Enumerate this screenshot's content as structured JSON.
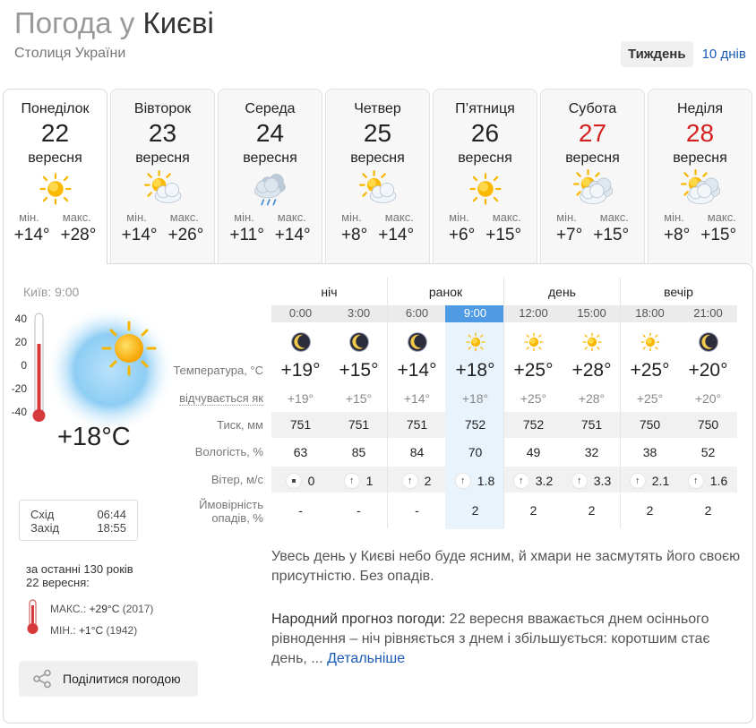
{
  "header": {
    "title_prefix": "Погода у",
    "city": "Києві",
    "subtitle": "Столиця України"
  },
  "period": {
    "week": "Тиждень",
    "ten_days": "10 днів"
  },
  "days": [
    {
      "name": "Понеділок",
      "num": "22",
      "month": "вересня",
      "icon": "sun-icon",
      "min_label": "мін.",
      "max_label": "макс.",
      "min": "+14°",
      "max": "+28°",
      "weekend": false
    },
    {
      "name": "Вівторок",
      "num": "23",
      "month": "вересня",
      "icon": "sun-cloud-icon",
      "min_label": "мін.",
      "max_label": "макс.",
      "min": "+14°",
      "max": "+26°",
      "weekend": false
    },
    {
      "name": "Середа",
      "num": "24",
      "month": "вересня",
      "icon": "rain-cloud-icon",
      "min_label": "мін.",
      "max_label": "макс.",
      "min": "+11°",
      "max": "+14°",
      "weekend": false
    },
    {
      "name": "Четвер",
      "num": "25",
      "month": "вересня",
      "icon": "sun-cloud-icon",
      "min_label": "мін.",
      "max_label": "макс.",
      "min": "+8°",
      "max": "+14°",
      "weekend": false
    },
    {
      "name": "П’ятниця",
      "num": "26",
      "month": "вересня",
      "icon": "sun-icon",
      "min_label": "мін.",
      "max_label": "макс.",
      "min": "+6°",
      "max": "+15°",
      "weekend": false
    },
    {
      "name": "Субота",
      "num": "27",
      "month": "вересня",
      "icon": "sun-clouds-icon",
      "min_label": "мін.",
      "max_label": "макс.",
      "min": "+7°",
      "max": "+15°",
      "weekend": true
    },
    {
      "name": "Неділя",
      "num": "28",
      "month": "вересня",
      "icon": "sun-clouds-icon",
      "min_label": "мін.",
      "max_label": "макс.",
      "min": "+8°",
      "max": "+15°",
      "weekend": true
    }
  ],
  "current": {
    "location_time": "Київ: 9:00",
    "temp": "+18°C",
    "thermo_ticks": [
      "40",
      "20",
      "0",
      "-20",
      "-40"
    ],
    "sunrise_label": "Схід",
    "sunrise": "06:44",
    "sunset_label": "Захід",
    "sunset": "18:55"
  },
  "history": {
    "line1": "за останні 130 років",
    "line2": "22 вересня:",
    "max_label": "МАКС.:",
    "max_val": "+29°C",
    "max_year": "(2017)",
    "min_label": "МІН.:",
    "min_val": "+1°C",
    "min_year": "(1942)"
  },
  "share_label": "Поділитися погодою",
  "row_labels": {
    "temp": "Температура, °C",
    "feels": "відчувається як",
    "pressure": "Тиск, мм",
    "humidity": "Вологість, %",
    "wind": "Вітер, м/с",
    "precip_line1": "Ймовірність",
    "precip_line2": "опадів, %"
  },
  "periods": [
    "ніч",
    "ранок",
    "день",
    "вечір"
  ],
  "hours": [
    {
      "time": "0:00",
      "icon": "moon-icon",
      "temp": "+19°",
      "feels": "+19°",
      "pressure": "751",
      "humidity": "63",
      "wind_dir": "calm-icon",
      "wind": "0",
      "precip": "-"
    },
    {
      "time": "3:00",
      "icon": "moon-icon",
      "temp": "+15°",
      "feels": "+15°",
      "pressure": "751",
      "humidity": "85",
      "wind_dir": "arrow-up-icon",
      "wind": "1",
      "precip": "-"
    },
    {
      "time": "6:00",
      "icon": "moon-icon",
      "temp": "+14°",
      "feels": "+14°",
      "pressure": "751",
      "humidity": "84",
      "wind_dir": "arrow-up-icon",
      "wind": "2",
      "precip": "-"
    },
    {
      "time": "9:00",
      "icon": "sun-icon",
      "temp": "+18°",
      "feels": "+18°",
      "pressure": "752",
      "humidity": "70",
      "wind_dir": "arrow-up-icon",
      "wind": "1.8",
      "precip": "2"
    },
    {
      "time": "12:00",
      "icon": "sun-icon",
      "temp": "+25°",
      "feels": "+25°",
      "pressure": "752",
      "humidity": "49",
      "wind_dir": "arrow-up-icon",
      "wind": "3.2",
      "precip": "2"
    },
    {
      "time": "15:00",
      "icon": "sun-icon",
      "temp": "+28°",
      "feels": "+28°",
      "pressure": "751",
      "humidity": "32",
      "wind_dir": "arrow-up-icon",
      "wind": "3.3",
      "precip": "2"
    },
    {
      "time": "18:00",
      "icon": "sun-icon",
      "temp": "+25°",
      "feels": "+25°",
      "pressure": "750",
      "humidity": "38",
      "wind_dir": "arrow-up-icon",
      "wind": "2.1",
      "precip": "2"
    },
    {
      "time": "21:00",
      "icon": "moon-icon",
      "temp": "+20°",
      "feels": "+20°",
      "pressure": "750",
      "humidity": "52",
      "wind_dir": "arrow-up-icon",
      "wind": "1.6",
      "precip": "2"
    }
  ],
  "description": "Увесь день у Києві небо буде ясним, й хмари не засмутять його своєю присутністю. Без опадів.",
  "folk": {
    "label": "Народний прогноз погоди:",
    "text": " 22 вересня вважається днем осіннього рівнодення – ніч рівняється з днем і збільшується: коротшим стає день, ... ",
    "more": "Детальніше"
  },
  "colors": {
    "accent": "#4f9be3",
    "link": "#1a5bb5",
    "weekend": "#d32020",
    "highlight": "#e9f3fc"
  }
}
